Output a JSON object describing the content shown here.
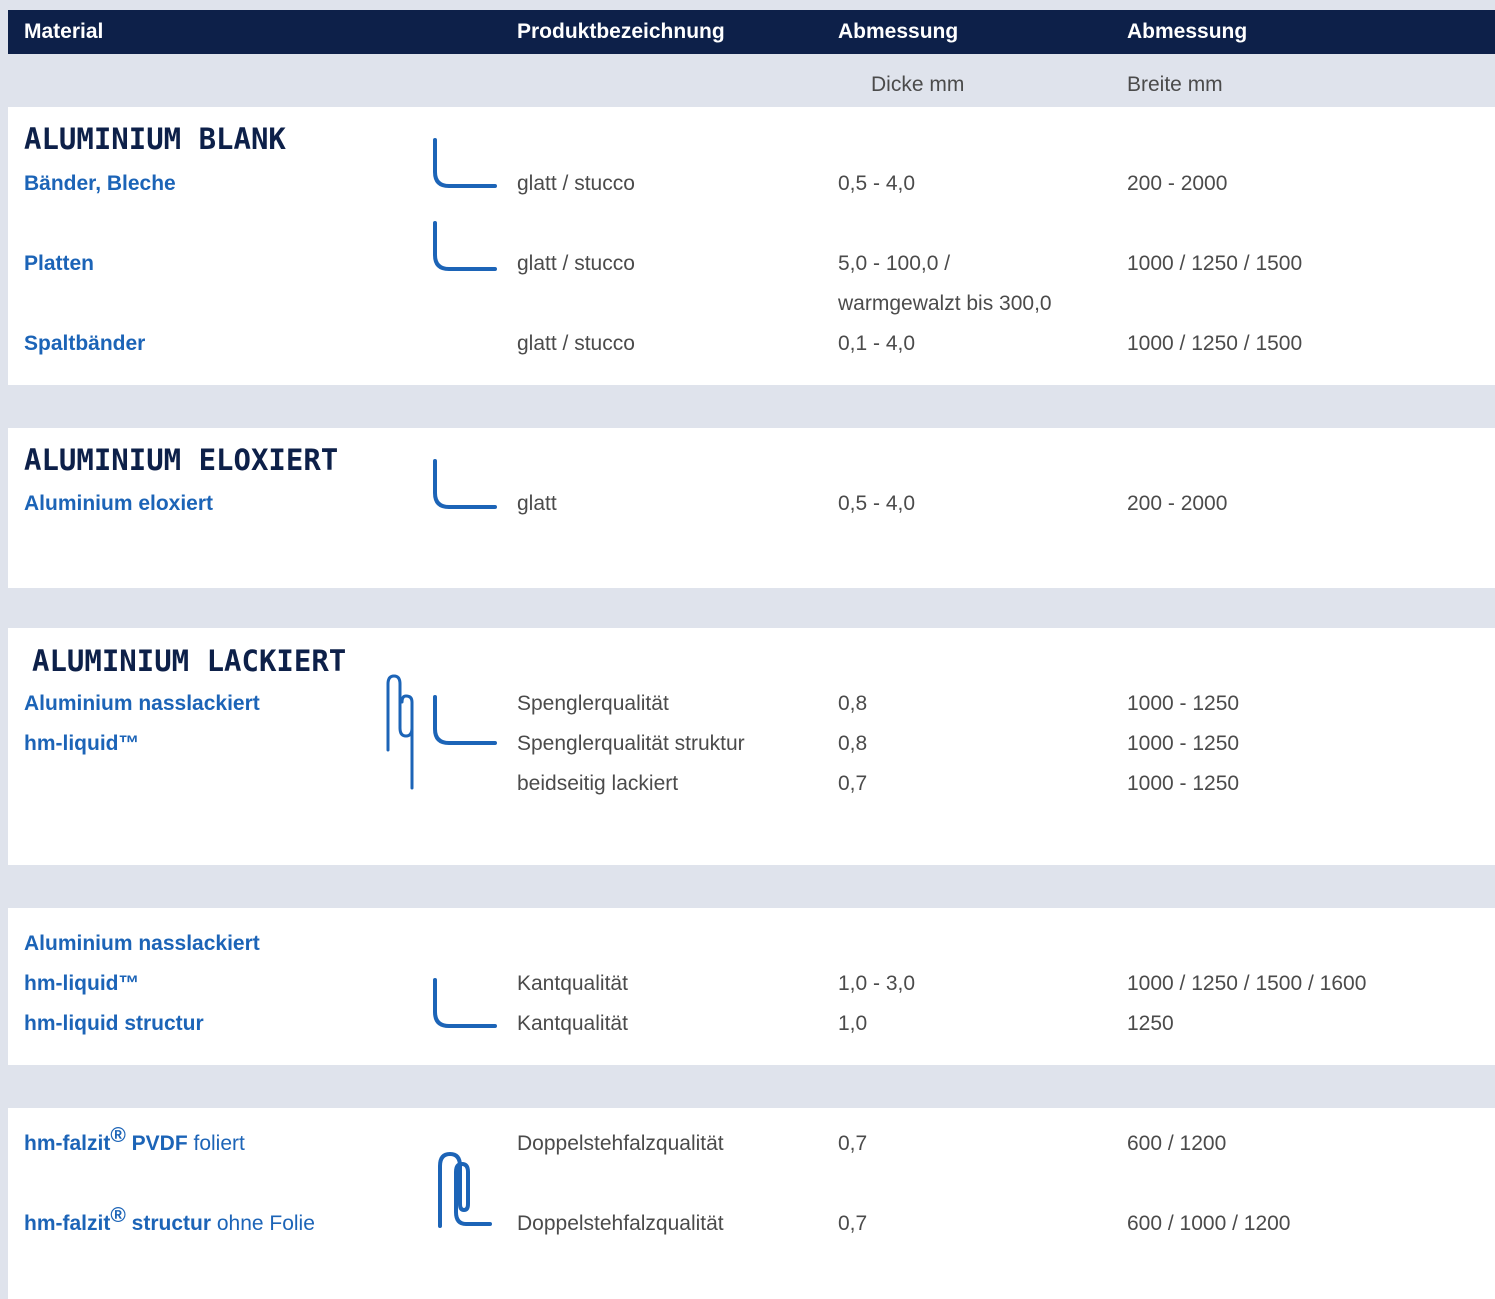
{
  "header": {
    "col1": "Material",
    "col2": "Produktbezeichnung",
    "col3": "Abmessung",
    "col4": "Abmessung"
  },
  "subheader": {
    "thickness": "Dicke mm",
    "width": "Breite mm"
  },
  "section1": {
    "title": "ALUMINIUM BLANK",
    "rows": [
      {
        "material": "Bänder, Bleche",
        "product": "glatt / stucco",
        "thickness": "0,5 - 4,0",
        "width": "200 - 2000"
      },
      {
        "material": "Platten",
        "product": "glatt / stucco",
        "thickness": "5,0 - 100,0 /",
        "thickness2": "warmgewalzt bis 300,0",
        "width": "1000 / 1250 / 1500"
      },
      {
        "material": "Spaltbänder",
        "product": "glatt / stucco",
        "thickness": "0,1 - 4,0",
        "width": "1000 / 1250 / 1500"
      }
    ]
  },
  "section2": {
    "title": "ALUMINIUM ELOXIERT",
    "rows": [
      {
        "material": "Aluminium eloxiert",
        "product": "glatt",
        "thickness": "0,5 - 4,0",
        "width": "200 - 2000"
      }
    ]
  },
  "section3": {
    "title": "ALUMINIUM LACKIERT",
    "material1": "Aluminium nasslackiert",
    "material2": "hm-liquid™",
    "rows": [
      {
        "product": "Spenglerqualität",
        "thickness": "0,8",
        "width": "1000 - 1250"
      },
      {
        "product": "Spenglerqualität struktur",
        "thickness": "0,8",
        "width": "1000 - 1250"
      },
      {
        "product": "beidseitig lackiert",
        "thickness": "0,7",
        "width": "1000 - 1250"
      }
    ]
  },
  "section4": {
    "material1": "Aluminium nasslackiert",
    "material2": "hm-liquid™",
    "material3": "hm-liquid structur",
    "rows": [
      {
        "product": "Kantqualität",
        "thickness": "1,0 - 3,0",
        "width": "1000 / 1250 / 1500 / 1600"
      },
      {
        "product": "Kantqualität",
        "thickness": "1,0",
        "width": "1250"
      }
    ]
  },
  "section5": {
    "rows": [
      {
        "brand": "hm-falzit",
        "reg": "®",
        "bold_suffix": " PVDF",
        "suffix": " foliert",
        "product": "Doppelstehfalzqualität",
        "thickness": "0,7",
        "width": "600 / 1200"
      },
      {
        "brand": "hm-falzit",
        "reg": "®",
        "bold_suffix": " structur",
        "suffix": " ohne Folie",
        "product": "Doppelstehfalzqualität",
        "thickness": "0,7",
        "width": "600 / 1000 / 1200"
      }
    ]
  },
  "icons": {
    "angle": "angle-profile-icon",
    "fold": "standing-seam-icon"
  },
  "colors": {
    "header_bg": "#0d2049",
    "accent_blue": "#1c64b7",
    "band_bg": "#dfe3ec",
    "text": "#4b4b4b"
  }
}
